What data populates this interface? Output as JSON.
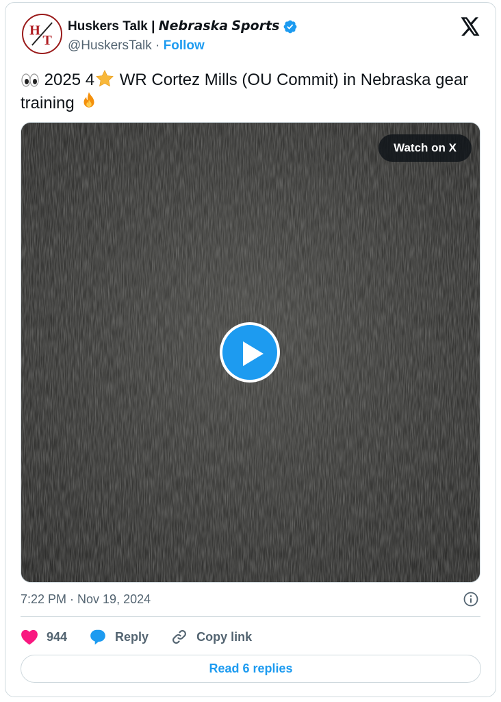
{
  "account": {
    "avatar_text": "H/T",
    "display_name": "Huskers Talk | 𝙉𝙚𝙗𝙧𝙖𝙨𝙠𝙖 𝙎𝙥𝙤𝙧𝙩𝙨",
    "verified_icon": "verified-badge-icon",
    "handle": "@HuskersTalk",
    "separator": "·",
    "follow_label": "Follow"
  },
  "platform_icon": "x-logo-icon",
  "tweet": {
    "text_part1": "2025 4",
    "text_part2": " WR Cortez Mills (OU Commit) in Nebraska gear training ",
    "emojis": [
      "eyes",
      "star",
      "fire"
    ]
  },
  "media": {
    "watch_label": "Watch on X",
    "play_icon": "play-icon"
  },
  "meta": {
    "timestamp": "7:22 PM · Nov 19, 2024",
    "info_icon": "info-icon"
  },
  "actions": {
    "like_count": "944",
    "reply_label": "Reply",
    "copy_label": "Copy link"
  },
  "read_replies_label": "Read 6 replies",
  "colors": {
    "accent": "#1d9bf0",
    "like": "#f91880",
    "text": "#0f1419",
    "muted": "#536471",
    "border": "#cfd9de"
  }
}
